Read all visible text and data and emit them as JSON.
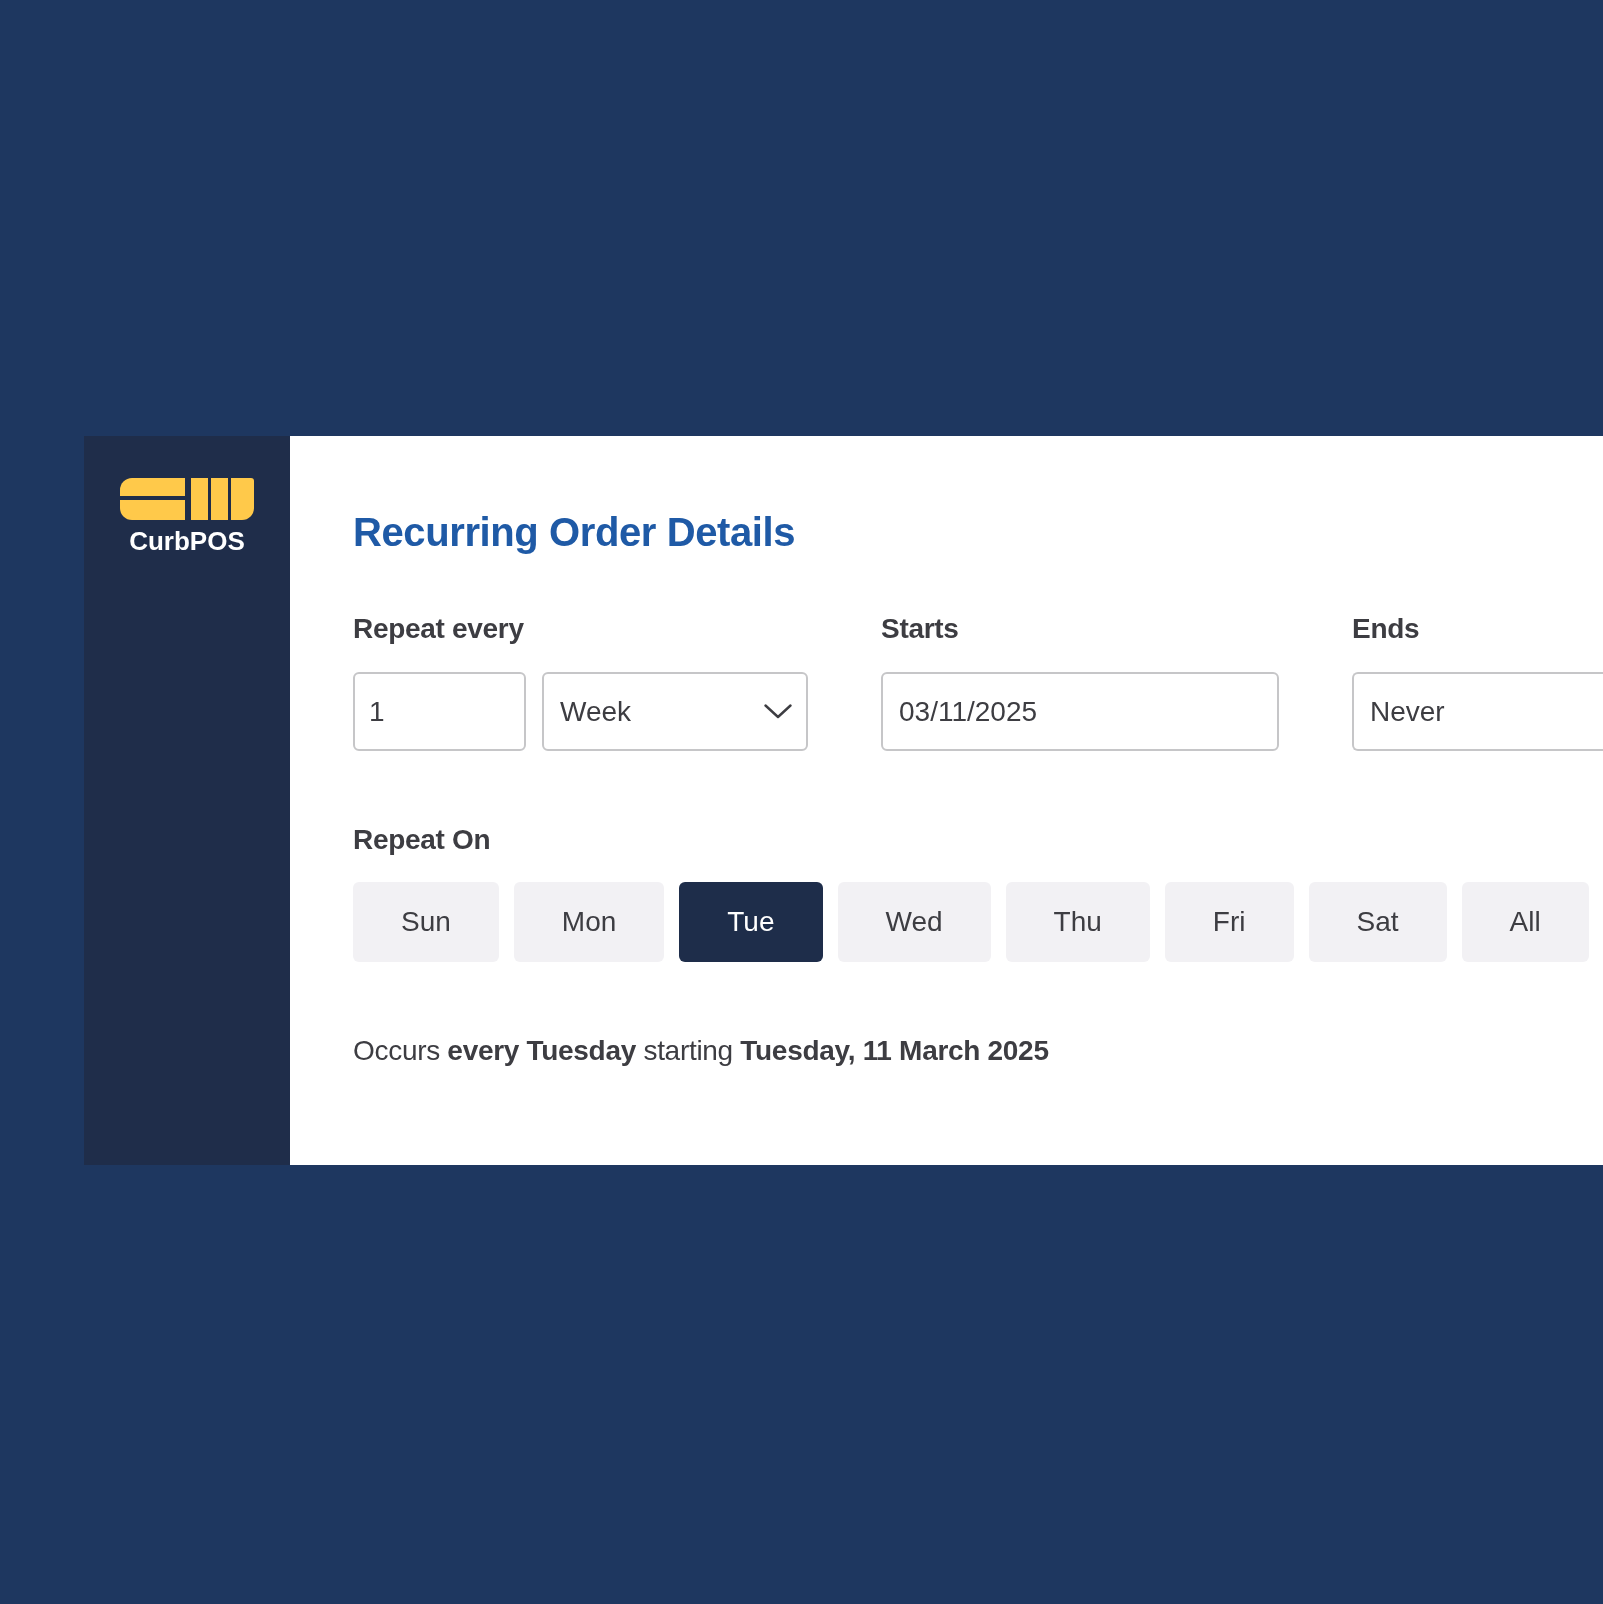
{
  "sidebar": {
    "brand": "CurbPOS"
  },
  "title": "Recurring Order Details",
  "repeat_every": {
    "label": "Repeat every",
    "count": "1",
    "unit": "Week"
  },
  "starts": {
    "label": "Starts",
    "value": "03/11/2025"
  },
  "ends": {
    "label": "Ends",
    "value": "Never"
  },
  "repeat_on": {
    "label": "Repeat On",
    "days": [
      {
        "label": "Sun",
        "selected": false
      },
      {
        "label": "Mon",
        "selected": false
      },
      {
        "label": "Tue",
        "selected": true
      },
      {
        "label": "Wed",
        "selected": false
      },
      {
        "label": "Thu",
        "selected": false
      },
      {
        "label": "Fri",
        "selected": false
      },
      {
        "label": "Sat",
        "selected": false
      },
      {
        "label": "All",
        "selected": false
      }
    ]
  },
  "summary": "Occurs **every Tuesday** starting **Tuesday, 11 March 2025**"
}
